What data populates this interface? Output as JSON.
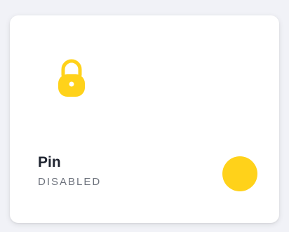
{
  "card": {
    "icon": "lock-icon",
    "title": "Pin",
    "status": "DISABLED",
    "toggle_icon": "toggle-dot"
  },
  "colors": {
    "background": "#f1f2f7",
    "card": "#ffffff",
    "accent": "#ffd21a",
    "title": "#1f2430",
    "status": "#6e737d"
  }
}
